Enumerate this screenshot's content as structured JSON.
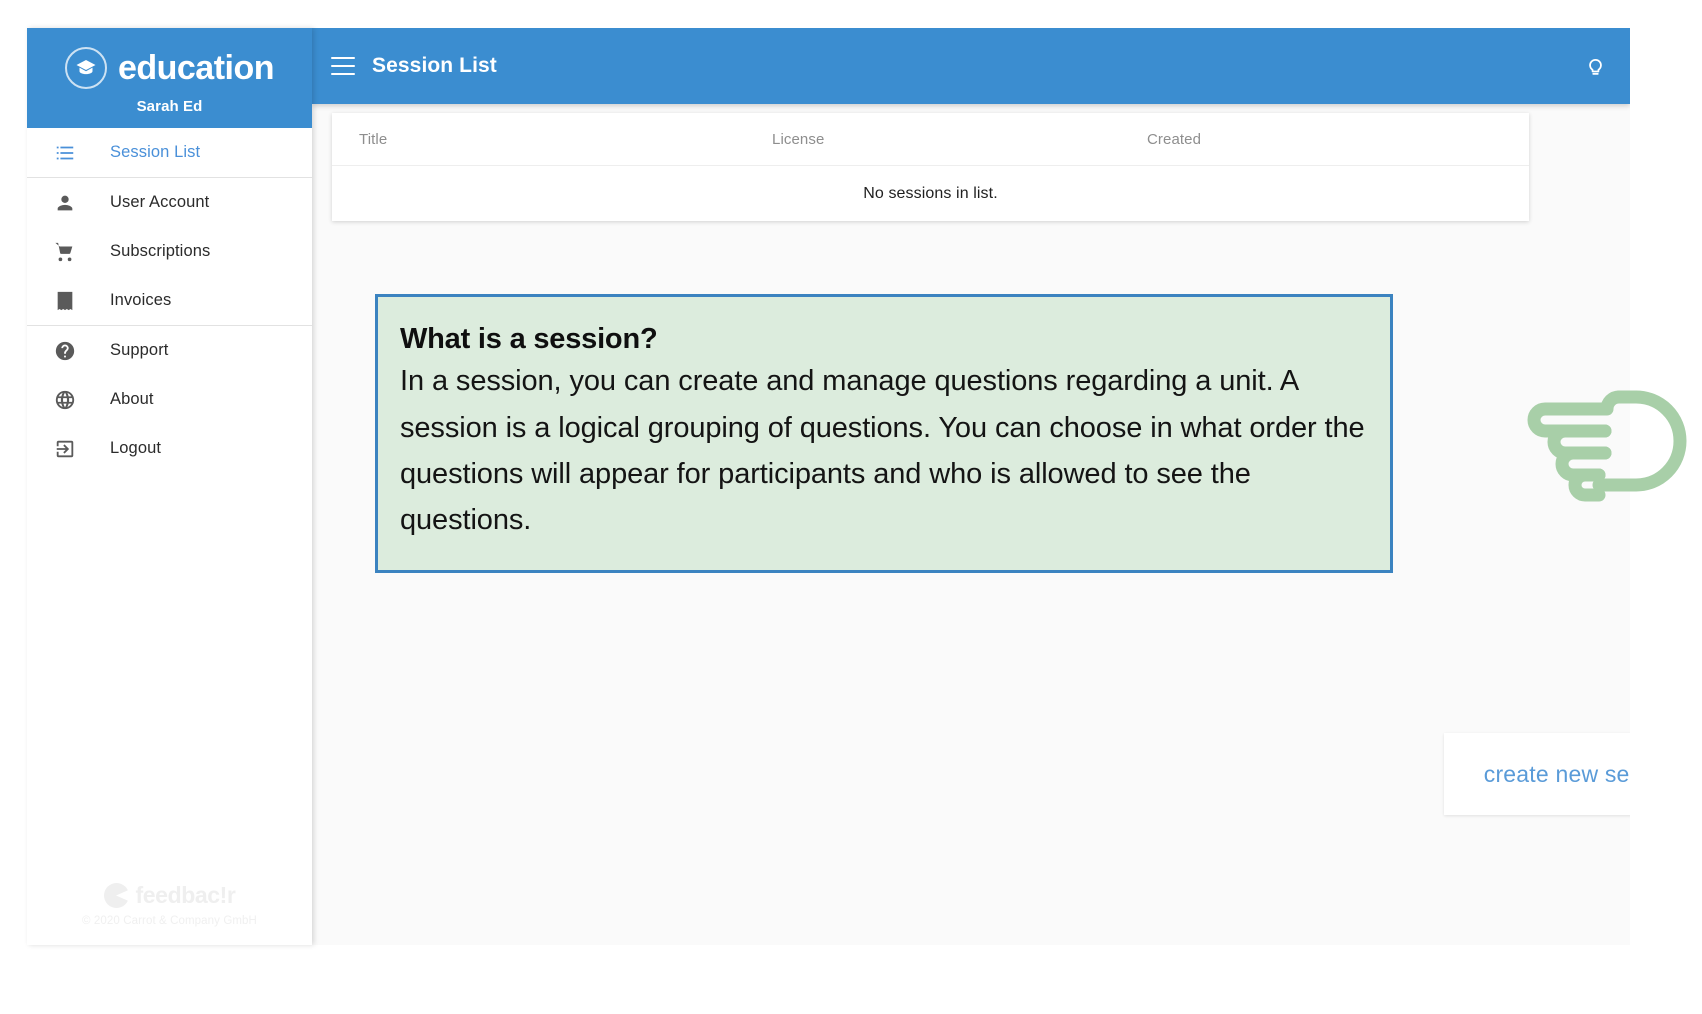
{
  "sidebar": {
    "brand": {
      "logo_icon": "graduation-cap-icon",
      "title": "education",
      "user": "Sarah Ed"
    },
    "items": [
      {
        "id": "session-list",
        "label": "Session List",
        "icon": "list-icon",
        "active": true,
        "divider_after": true
      },
      {
        "id": "user-account",
        "label": "User Account",
        "icon": "person-icon",
        "active": false,
        "divider_after": false
      },
      {
        "id": "subscriptions",
        "label": "Subscriptions",
        "icon": "cart-icon",
        "active": false,
        "divider_after": false
      },
      {
        "id": "invoices",
        "label": "Invoices",
        "icon": "receipt-icon",
        "active": false,
        "divider_after": true
      },
      {
        "id": "support",
        "label": "Support",
        "icon": "help-icon",
        "active": false,
        "divider_after": false
      },
      {
        "id": "about",
        "label": "About",
        "icon": "globe-icon",
        "active": false,
        "divider_after": false
      },
      {
        "id": "logout",
        "label": "Logout",
        "icon": "exit-icon",
        "active": false,
        "divider_after": false
      }
    ],
    "footer": {
      "brand_mark_icon": "feedbackr-mark-icon",
      "brand_name": "feedbacǃr",
      "copyright": "© 2020 Carrot & Company GmbH"
    }
  },
  "topbar": {
    "menu_icon": "hamburger-icon",
    "title": "Session List",
    "hint_icon": "lightbulb-icon"
  },
  "session_table": {
    "columns": [
      "Title",
      "License",
      "Created"
    ],
    "rows": [],
    "empty_message": "No sessions in list."
  },
  "info_callout": {
    "heading": "What is a session?",
    "body": "In a session, you can create and manage questions regarding a unit. A session is a logical grouping of questions. You can choose in what order the questions will appear for participants and who is allowed to see the questions."
  },
  "create_tooltip": {
    "label": "create new session"
  },
  "fab": {
    "label": "+",
    "icon": "plus-icon"
  },
  "pointer": {
    "icon": "pointing-hand-left-icon"
  },
  "colors": {
    "brand_blue": "#3b8dd0",
    "accent_link": "#4a90d9",
    "callout_bg": "#dcecdd",
    "callout_border": "#3b83c0",
    "fab_green": "#7ac427",
    "hand_green": "#a8cfa8"
  }
}
